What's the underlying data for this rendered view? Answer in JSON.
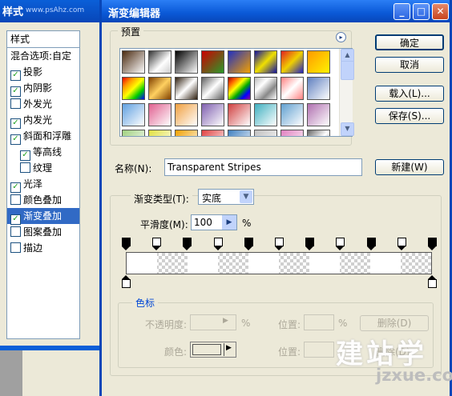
{
  "background_window": {
    "title": "样式",
    "title_watermark": "www.psAhz.com",
    "style_header": "样式",
    "items": [
      {
        "label": "混合选项:自定",
        "checked": null,
        "indent": false,
        "active": false
      },
      {
        "label": "投影",
        "checked": true,
        "indent": false,
        "active": false
      },
      {
        "label": "内阴影",
        "checked": true,
        "indent": false,
        "active": false
      },
      {
        "label": "外发光",
        "checked": false,
        "indent": false,
        "active": false
      },
      {
        "label": "内发光",
        "checked": true,
        "indent": false,
        "active": false
      },
      {
        "label": "斜面和浮雕",
        "checked": true,
        "indent": false,
        "active": false
      },
      {
        "label": "等高线",
        "checked": true,
        "indent": true,
        "active": false
      },
      {
        "label": "纹理",
        "checked": false,
        "indent": true,
        "active": false
      },
      {
        "label": "光泽",
        "checked": true,
        "indent": false,
        "active": false
      },
      {
        "label": "颜色叠加",
        "checked": false,
        "indent": false,
        "active": false
      },
      {
        "label": "渐变叠加",
        "checked": true,
        "indent": false,
        "active": true
      },
      {
        "label": "图案叠加",
        "checked": false,
        "indent": false,
        "active": false
      },
      {
        "label": "描边",
        "checked": false,
        "indent": false,
        "active": false
      }
    ]
  },
  "dialog": {
    "title": "渐变编辑器",
    "window_buttons": {
      "minimize": "_",
      "maximize": "□",
      "close": "✕"
    },
    "presets_label": "预置",
    "presets_menu_icon": "▸",
    "buttons": {
      "ok": "确定",
      "cancel": "取消",
      "load": "载入(L)...",
      "save": "保存(S)..."
    },
    "scroll_up": "▲",
    "scroll_down": "▼",
    "name_label": "名称(N):",
    "name_value": "Transparent Stripes",
    "new_button": "新建(W)",
    "gradient_type_label": "渐变类型(T):",
    "gradient_type_value": "实底",
    "dropdown_arrow": "▼",
    "smoothness_label": "平滑度(M):",
    "smoothness_value": "100",
    "smoothness_arrow": "▶",
    "smoothness_unit": "%",
    "color_stops": {
      "group_label": "色标",
      "opacity_label": "不透明度:",
      "opacity_unit": "%",
      "opacity_arrow": "▶",
      "location_label": "位置:",
      "location_unit": "%",
      "delete_button": "删除(D)",
      "color_label": "颜色:",
      "color_arrow": "▶",
      "location2_label": "位置:",
      "delete2_button": "删除(D)"
    }
  },
  "preset_swatches": [
    "linear-gradient(135deg,#4a2a10,#fff)",
    "linear-gradient(135deg,#333,#fff 60%,#ccc)",
    "linear-gradient(135deg,#000,#fff)",
    "linear-gradient(135deg,#c00,#2a9a2a)",
    "linear-gradient(135deg,#2030c0,#f2a000)",
    "linear-gradient(135deg,#1010a0,#f0e000,#1010a0)",
    "linear-gradient(135deg,#e02020,#f0d000,#2020c0)",
    "linear-gradient(135deg,#ff9a00,#fff200)",
    "linear-gradient(135deg,#e00,#f90,#ff0,#0c0,#00f)",
    "linear-gradient(135deg,#804000,#ffd060,#804000)",
    "linear-gradient(135deg,#302010,#fff,#302010)",
    "linear-gradient(135deg,#606060,#fff,#606060)",
    "linear-gradient(135deg,#a00,#f60,#ff0,#0a0,#00f,#909)",
    "linear-gradient(135deg,#bbb,#fff,#888,#fff)",
    "linear-gradient(135deg,#ff8080,#fff,#ff8080)",
    "linear-gradient(135deg,#6080c0,#fff)",
    "linear-gradient(135deg,#60a0e0,#fff)",
    "linear-gradient(135deg,#e06090,#fff)",
    "linear-gradient(135deg,#f0a040,#fff)",
    "linear-gradient(135deg,#8060b0,#fff)",
    "linear-gradient(135deg,#d04040,#fff)",
    "linear-gradient(135deg,#40b0c0,#fff)",
    "linear-gradient(135deg,#60a0d0,#fff)",
    "linear-gradient(135deg,#b070b0,#fff)",
    "linear-gradient(135deg,#a0d080,#fff)",
    "linear-gradient(135deg,#e0e040,#fff)",
    "linear-gradient(135deg,#f0a000,#fff)",
    "linear-gradient(135deg,#e04040,#fff)",
    "linear-gradient(135deg,#4080c0,#fff)",
    "linear-gradient(135deg,#c0c0c0,#fff)",
    "linear-gradient(135deg,#e080c0,#fff)",
    "linear-gradient(135deg,#666,#fff,#666)"
  ],
  "gradient_segments": [
    {
      "opaque": true
    },
    {
      "opaque": false
    },
    {
      "opaque": true
    },
    {
      "opaque": false
    },
    {
      "opaque": true
    },
    {
      "opaque": false
    },
    {
      "opaque": true
    },
    {
      "opaque": false
    },
    {
      "opaque": true
    },
    {
      "opaque": false
    }
  ],
  "opacity_stop_count": 11,
  "color_stop_count": 2,
  "watermark": {
    "logo": "建站学",
    "url": "jzxue.com"
  }
}
